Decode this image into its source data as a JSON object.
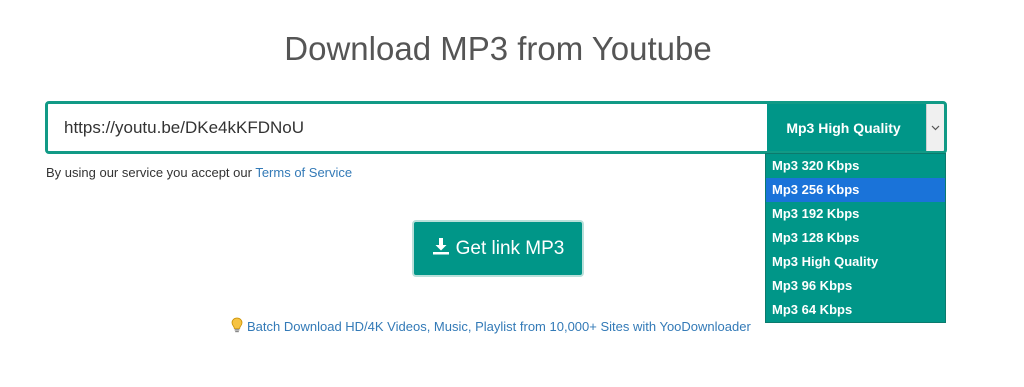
{
  "page": {
    "title": "Download MP3 from Youtube"
  },
  "form": {
    "url_value": "https://youtu.be/DKe4kKFDNoU",
    "quality_selected": "Mp3 High Quality"
  },
  "tos": {
    "prefix": "By using our service you accept our ",
    "link": "Terms of Service"
  },
  "get_button": {
    "label": "Get link MP3",
    "icon": "download-icon"
  },
  "batch": {
    "icon": "lightbulb-icon",
    "text": "Batch Download HD/4K Videos, Music, Playlist from 10,000+ Sites with YooDownloader"
  },
  "dropdown": {
    "options": [
      "Mp3 320 Kbps",
      "Mp3 256 Kbps",
      "Mp3 192 Kbps",
      "Mp3 128 Kbps",
      "Mp3 High Quality",
      "Mp3 96 Kbps",
      "Mp3 64 Kbps"
    ],
    "highlighted": "Mp3 256 Kbps"
  },
  "colors": {
    "accent": "#009688",
    "highlight": "#1a73d9",
    "link": "#337ab7",
    "title": "#555555"
  }
}
